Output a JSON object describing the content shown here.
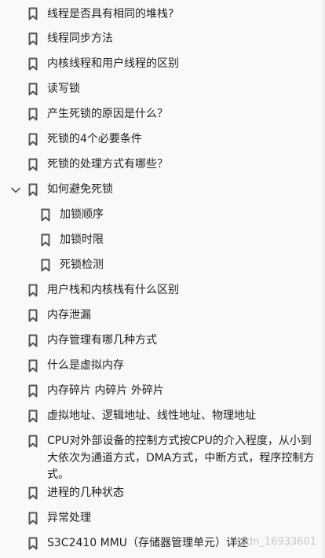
{
  "outline": {
    "items": [
      {
        "label": "线程是否具有相同的堆栈?"
      },
      {
        "label": "线程同步方法"
      },
      {
        "label": "内核线程和用户线程的区别"
      },
      {
        "label": "读写锁"
      },
      {
        "label": "产生死锁的原因是什么？"
      },
      {
        "label": "死锁的4个必要条件"
      },
      {
        "label": "死锁的处理方式有哪些？"
      },
      {
        "label": "如何避免死锁",
        "expanded": true
      },
      {
        "label": "加锁顺序"
      },
      {
        "label": "加锁时限"
      },
      {
        "label": "死锁检测"
      },
      {
        "label": "用户栈和内核栈有什么区别"
      },
      {
        "label": "内存泄漏"
      },
      {
        "label": "内存管理有哪几种方式"
      },
      {
        "label": "什么是虚拟内存"
      },
      {
        "label": "内存碎片 内碎片 外碎片"
      },
      {
        "label": "虚拟地址、逻辑地址、线性地址、物理地址"
      },
      {
        "label": "CPU对外部设备的控制方式按CPU的介入程度，从小到大依次为通道方式，DMA方式，中断方式，程序控制方式。"
      },
      {
        "label": "进程的几种状态"
      },
      {
        "label": "异常处理"
      },
      {
        "label": "S3C2410 MMU（存储器管理单元）详述"
      }
    ]
  },
  "watermark": "csdn_16933601",
  "colors": {
    "background": "#f9f9f9",
    "icon": "#555555",
    "text": "#222222"
  }
}
